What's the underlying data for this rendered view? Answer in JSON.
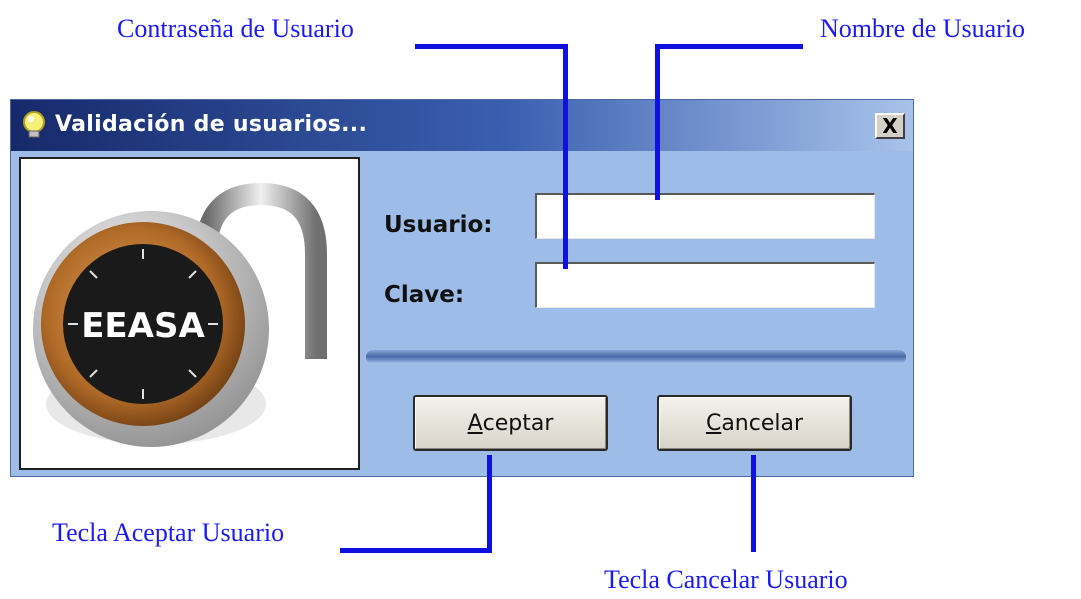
{
  "annotations": {
    "password": "Contraseña de Usuario",
    "username": "Nombre de Usuario",
    "accept": "Tecla Aceptar Usuario",
    "cancel": "Tecla Cancelar Usuario"
  },
  "dialog": {
    "title": "Validación de usuarios...",
    "close_label": "X",
    "lock_text": "EEASA",
    "fields": {
      "user_label": "Usuario:",
      "user_value": "",
      "password_label": "Clave:",
      "password_value": ""
    },
    "buttons": {
      "accept_first": "A",
      "accept_rest": "ceptar",
      "cancel_first": "C",
      "cancel_rest": "ancelar"
    }
  },
  "colors": {
    "annotation": "#1a1aff",
    "dialog_body": "#9dbce8",
    "titlebar_start": "#16296a"
  }
}
